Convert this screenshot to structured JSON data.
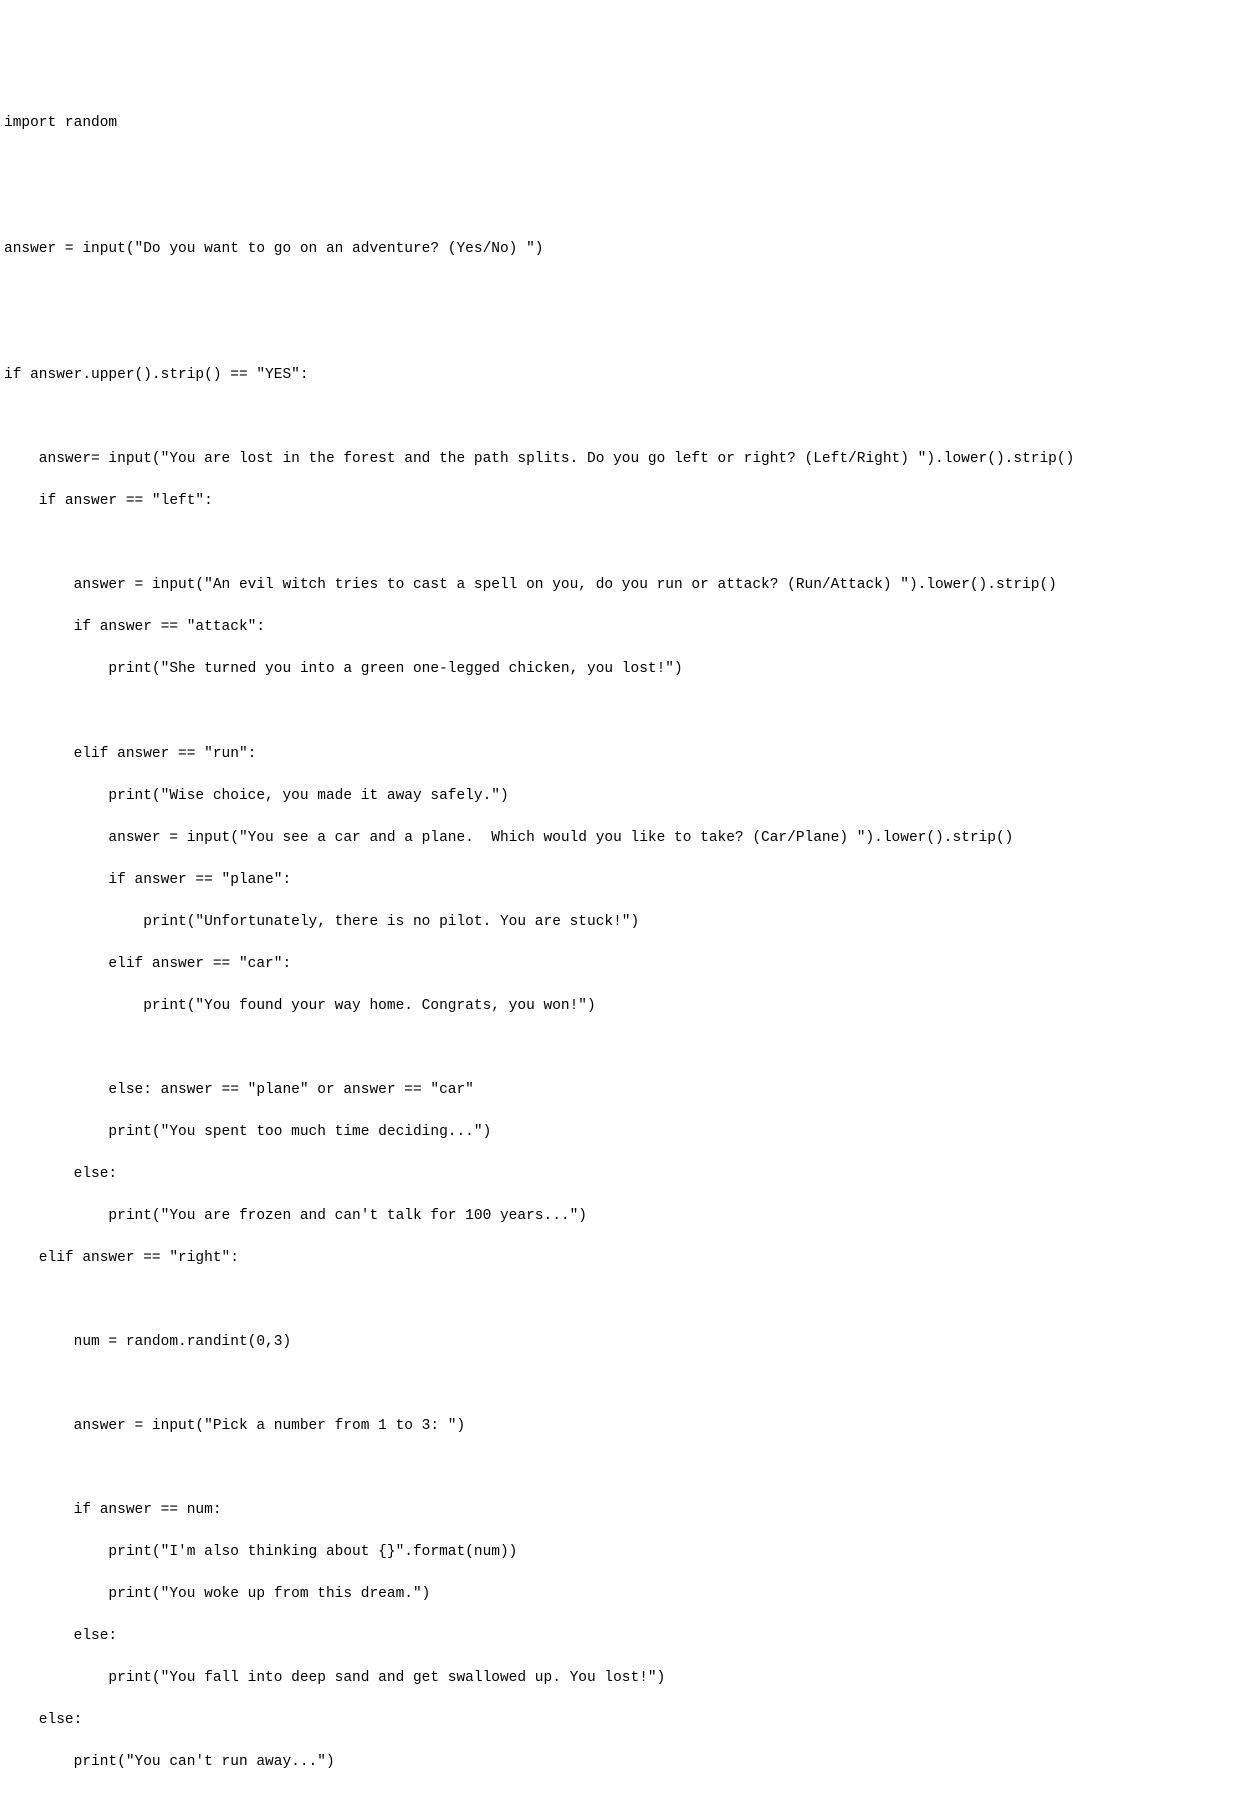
{
  "code": {
    "lines": [
      "import random",
      "",
      "",
      "answer = input(\"Do you want to go on an adventure? (Yes/No) \")",
      "",
      "",
      "if answer.upper().strip() == \"YES\":",
      "",
      "    answer= input(\"You are lost in the forest and the path splits. Do you go left or right? (Left/Right) \").lower().strip()",
      "    if answer == \"left\":",
      "",
      "        answer = input(\"An evil witch tries to cast a spell on you, do you run or attack? (Run/Attack) \").lower().strip()",
      "        if answer == \"attack\":",
      "            print(\"She turned you into a green one-legged chicken, you lost!\")",
      "",
      "        elif answer == \"run\":",
      "            print(\"Wise choice, you made it away safely.\")",
      "            answer = input(\"You see a car and a plane.  Which would you like to take? (Car/Plane) \").lower().strip()",
      "            if answer == \"plane\":",
      "                print(\"Unfortunately, there is no pilot. You are stuck!\")",
      "            elif answer == \"car\":",
      "                print(\"You found your way home. Congrats, you won!\")",
      "",
      "            else: answer == \"plane\" or answer == \"car\"",
      "            print(\"You spent too much time deciding...\")",
      "        else:",
      "            print(\"You are frozen and can't talk for 100 years...\")",
      "    elif answer == \"right\":",
      "",
      "        num = random.randint(0,3)",
      "",
      "        answer = input(\"Pick a number from 1 to 3: \")",
      "",
      "        if answer == num:",
      "            print(\"I'm also thinking about {}\".format(num))",
      "            print(\"You woke up from this dream.\")",
      "        else:",
      "            print(\"You fall into deep sand and get swallowed up. You lost!\")",
      "    else:",
      "        print(\"You can't run away...\")"
    ]
  }
}
